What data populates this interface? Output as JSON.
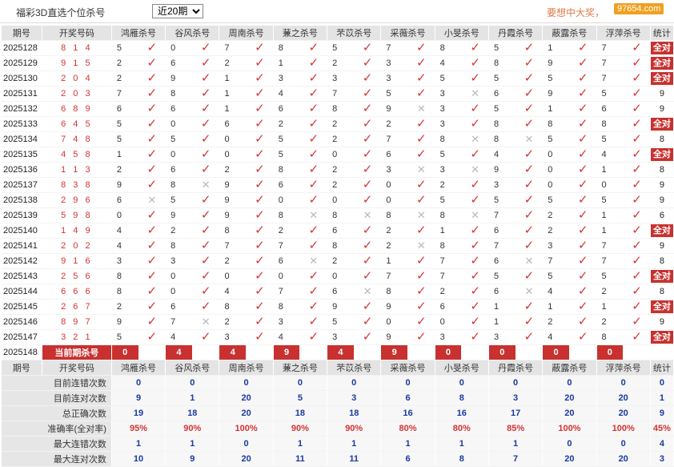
{
  "header": {
    "title": "福彩3D直选个位杀号",
    "period_select": "近20期",
    "slogan": "要想中大奖，",
    "brand": "97654.com"
  },
  "columns": {
    "issue": "期号",
    "number": "开奖号码",
    "experts": [
      "鸿雁杀号",
      "谷风杀号",
      "周南杀号",
      "蒹之杀号",
      "芣苡杀号",
      "采薇杀号",
      "小旻杀号",
      "丹霞杀号",
      "蔽露杀号",
      "浮萍杀号"
    ],
    "stats": "统计"
  },
  "full_badge": "全对",
  "rows": [
    {
      "issue": "2025128",
      "num": "8 1 4",
      "kills": [
        [
          5,
          1
        ],
        [
          0,
          1
        ],
        [
          7,
          1
        ],
        [
          8,
          1
        ],
        [
          5,
          1
        ],
        [
          7,
          1
        ],
        [
          8,
          1
        ],
        [
          5,
          1
        ],
        [
          1,
          1
        ],
        [
          7,
          1
        ]
      ],
      "stat": "全对"
    },
    {
      "issue": "2025129",
      "num": "9 1 5",
      "kills": [
        [
          2,
          1
        ],
        [
          6,
          1
        ],
        [
          2,
          1
        ],
        [
          1,
          1
        ],
        [
          2,
          1
        ],
        [
          3,
          1
        ],
        [
          4,
          1
        ],
        [
          8,
          1
        ],
        [
          9,
          1
        ],
        [
          7,
          1
        ]
      ],
      "stat": "全对"
    },
    {
      "issue": "2025130",
      "num": "2 0 4",
      "kills": [
        [
          2,
          1
        ],
        [
          9,
          1
        ],
        [
          1,
          1
        ],
        [
          3,
          1
        ],
        [
          3,
          1
        ],
        [
          3,
          1
        ],
        [
          5,
          1
        ],
        [
          5,
          1
        ],
        [
          5,
          1
        ],
        [
          7,
          1
        ]
      ],
      "stat": "全对"
    },
    {
      "issue": "2025131",
      "num": "2 0 3",
      "kills": [
        [
          7,
          1
        ],
        [
          8,
          1
        ],
        [
          1,
          1
        ],
        [
          4,
          1
        ],
        [
          7,
          1
        ],
        [
          5,
          1
        ],
        [
          3,
          0
        ],
        [
          6,
          1
        ],
        [
          9,
          1
        ],
        [
          5,
          1
        ]
      ],
      "stat": "9"
    },
    {
      "issue": "2025132",
      "num": "6 8 9",
      "kills": [
        [
          6,
          1
        ],
        [
          6,
          1
        ],
        [
          1,
          1
        ],
        [
          6,
          1
        ],
        [
          8,
          1
        ],
        [
          9,
          0
        ],
        [
          3,
          1
        ],
        [
          5,
          1
        ],
        [
          1,
          1
        ],
        [
          6,
          1
        ]
      ],
      "stat": "9"
    },
    {
      "issue": "2025133",
      "num": "6 4 5",
      "kills": [
        [
          5,
          1
        ],
        [
          0,
          1
        ],
        [
          6,
          1
        ],
        [
          2,
          1
        ],
        [
          2,
          1
        ],
        [
          2,
          1
        ],
        [
          3,
          1
        ],
        [
          8,
          1
        ],
        [
          8,
          1
        ],
        [
          8,
          1
        ]
      ],
      "stat": "全对"
    },
    {
      "issue": "2025134",
      "num": "7 4 8",
      "kills": [
        [
          5,
          1
        ],
        [
          5,
          1
        ],
        [
          0,
          1
        ],
        [
          5,
          1
        ],
        [
          2,
          1
        ],
        [
          7,
          1
        ],
        [
          8,
          0
        ],
        [
          8,
          0
        ],
        [
          5,
          1
        ],
        [
          5,
          1
        ]
      ],
      "stat": "8"
    },
    {
      "issue": "2025135",
      "num": "4 5 8",
      "kills": [
        [
          1,
          1
        ],
        [
          0,
          1
        ],
        [
          0,
          1
        ],
        [
          5,
          1
        ],
        [
          0,
          1
        ],
        [
          6,
          1
        ],
        [
          5,
          1
        ],
        [
          4,
          1
        ],
        [
          0,
          1
        ],
        [
          4,
          1
        ]
      ],
      "stat": "全对"
    },
    {
      "issue": "2025136",
      "num": "1 1 3",
      "kills": [
        [
          2,
          1
        ],
        [
          6,
          1
        ],
        [
          2,
          1
        ],
        [
          8,
          1
        ],
        [
          2,
          1
        ],
        [
          3,
          0
        ],
        [
          3,
          0
        ],
        [
          9,
          1
        ],
        [
          0,
          1
        ],
        [
          1,
          1
        ]
      ],
      "stat": "8"
    },
    {
      "issue": "2025137",
      "num": "8 3 8",
      "kills": [
        [
          9,
          1
        ],
        [
          8,
          0
        ],
        [
          9,
          1
        ],
        [
          6,
          1
        ],
        [
          2,
          1
        ],
        [
          0,
          1
        ],
        [
          2,
          1
        ],
        [
          3,
          1
        ],
        [
          0,
          1
        ],
        [
          0,
          1
        ]
      ],
      "stat": "9"
    },
    {
      "issue": "2025138",
      "num": "2 9 6",
      "kills": [
        [
          6,
          0
        ],
        [
          5,
          1
        ],
        [
          9,
          1
        ],
        [
          0,
          1
        ],
        [
          0,
          1
        ],
        [
          0,
          1
        ],
        [
          5,
          1
        ],
        [
          5,
          1
        ],
        [
          5,
          1
        ],
        [
          5,
          1
        ]
      ],
      "stat": "9"
    },
    {
      "issue": "2025139",
      "num": "5 9 8",
      "kills": [
        [
          0,
          1
        ],
        [
          9,
          1
        ],
        [
          9,
          1
        ],
        [
          8,
          0
        ],
        [
          8,
          0
        ],
        [
          8,
          0
        ],
        [
          8,
          0
        ],
        [
          7,
          1
        ],
        [
          2,
          1
        ],
        [
          1,
          1
        ]
      ],
      "stat": "6"
    },
    {
      "issue": "2025140",
      "num": "1 4 9",
      "kills": [
        [
          4,
          1
        ],
        [
          2,
          1
        ],
        [
          8,
          1
        ],
        [
          2,
          1
        ],
        [
          6,
          1
        ],
        [
          2,
          1
        ],
        [
          1,
          1
        ],
        [
          6,
          1
        ],
        [
          2,
          1
        ],
        [
          1,
          1
        ]
      ],
      "stat": "全对"
    },
    {
      "issue": "2025141",
      "num": "2 0 2",
      "kills": [
        [
          4,
          1
        ],
        [
          8,
          1
        ],
        [
          7,
          1
        ],
        [
          7,
          1
        ],
        [
          8,
          1
        ],
        [
          2,
          0
        ],
        [
          8,
          1
        ],
        [
          7,
          1
        ],
        [
          3,
          1
        ],
        [
          7,
          1
        ]
      ],
      "stat": "9"
    },
    {
      "issue": "2025142",
      "num": "9 1 6",
      "kills": [
        [
          3,
          1
        ],
        [
          3,
          1
        ],
        [
          2,
          1
        ],
        [
          6,
          0
        ],
        [
          2,
          1
        ],
        [
          1,
          1
        ],
        [
          7,
          1
        ],
        [
          6,
          0
        ],
        [
          7,
          1
        ],
        [
          7,
          1
        ]
      ],
      "stat": "8"
    },
    {
      "issue": "2025143",
      "num": "2 5 6",
      "kills": [
        [
          8,
          1
        ],
        [
          0,
          1
        ],
        [
          0,
          1
        ],
        [
          0,
          1
        ],
        [
          0,
          1
        ],
        [
          7,
          1
        ],
        [
          7,
          1
        ],
        [
          5,
          1
        ],
        [
          5,
          1
        ],
        [
          5,
          1
        ]
      ],
      "stat": "全对"
    },
    {
      "issue": "2025144",
      "num": "6 6 6",
      "kills": [
        [
          8,
          1
        ],
        [
          0,
          1
        ],
        [
          4,
          1
        ],
        [
          7,
          1
        ],
        [
          6,
          0
        ],
        [
          8,
          1
        ],
        [
          2,
          1
        ],
        [
          6,
          0
        ],
        [
          4,
          1
        ],
        [
          2,
          1
        ]
      ],
      "stat": "8"
    },
    {
      "issue": "2025145",
      "num": "2 6 7",
      "kills": [
        [
          2,
          1
        ],
        [
          6,
          1
        ],
        [
          8,
          1
        ],
        [
          8,
          1
        ],
        [
          9,
          1
        ],
        [
          9,
          1
        ],
        [
          6,
          1
        ],
        [
          1,
          1
        ],
        [
          1,
          1
        ],
        [
          1,
          1
        ]
      ],
      "stat": "全对"
    },
    {
      "issue": "2025146",
      "num": "8 9 7",
      "kills": [
        [
          9,
          1
        ],
        [
          7,
          0
        ],
        [
          2,
          1
        ],
        [
          3,
          1
        ],
        [
          5,
          1
        ],
        [
          0,
          1
        ],
        [
          0,
          1
        ],
        [
          1,
          1
        ],
        [
          2,
          1
        ],
        [
          2,
          1
        ]
      ],
      "stat": "9"
    },
    {
      "issue": "2025147",
      "num": "3 2 1",
      "kills": [
        [
          5,
          1
        ],
        [
          4,
          1
        ],
        [
          3,
          1
        ],
        [
          4,
          1
        ],
        [
          3,
          1
        ],
        [
          9,
          1
        ],
        [
          3,
          1
        ],
        [
          3,
          1
        ],
        [
          4,
          1
        ],
        [
          8,
          1
        ]
      ],
      "stat": "全对"
    }
  ],
  "current": {
    "issue": "2025148",
    "label": "当前期杀号",
    "kills": [
      "0",
      "4",
      "4",
      "9",
      "4",
      "9",
      "0",
      "0",
      "0",
      "0"
    ]
  },
  "summary_labels": [
    "目前连错次数",
    "目前连对次数",
    "总正确次数",
    "准确率(全对率)",
    "最大连错次数",
    "最大连对次数"
  ],
  "summary": [
    [
      "0",
      "0",
      "0",
      "0",
      "0",
      "0",
      "0",
      "0",
      "0",
      "0",
      "0"
    ],
    [
      "9",
      "1",
      "20",
      "5",
      "3",
      "6",
      "8",
      "3",
      "20",
      "20",
      "1"
    ],
    [
      "19",
      "18",
      "20",
      "18",
      "18",
      "16",
      "16",
      "17",
      "20",
      "20",
      "9"
    ],
    [
      "95%",
      "90%",
      "100%",
      "90%",
      "90%",
      "80%",
      "80%",
      "85%",
      "100%",
      "100%",
      "45%"
    ],
    [
      "1",
      "1",
      "0",
      "1",
      "1",
      "1",
      "1",
      "1",
      "0",
      "0",
      "4"
    ],
    [
      "10",
      "9",
      "20",
      "11",
      "11",
      "6",
      "8",
      "7",
      "20",
      "20",
      "3"
    ]
  ]
}
